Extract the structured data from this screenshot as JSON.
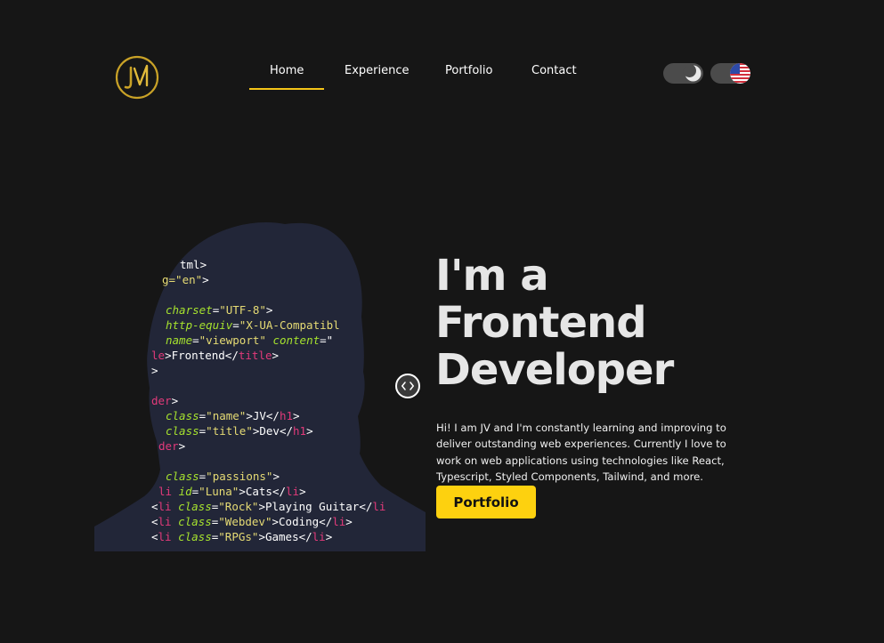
{
  "brand": {
    "logo_text": "JV",
    "accent": "#d4a017"
  },
  "nav": {
    "items": [
      {
        "label": "Home",
        "active": true
      },
      {
        "label": "Experience",
        "active": false
      },
      {
        "label": "Portfolio",
        "active": false
      },
      {
        "label": "Contact",
        "active": false
      }
    ],
    "active_color": "#f5c518"
  },
  "controls": {
    "theme_toggle": {
      "icon": "moon-icon",
      "mode": "dark"
    },
    "language_toggle": {
      "icon": "us-flag-icon"
    }
  },
  "hero_code": [
    [
      [
        "tag",
        "tml>"
      ]
    ],
    [
      [
        "str",
        "g=\"en\""
      ],
      [
        "tag",
        ">"
      ]
    ],
    [],
    [
      [
        "attr",
        "charset"
      ],
      [
        "tag",
        "="
      ],
      [
        "str",
        "\"UTF-8\""
      ],
      [
        "tag",
        ">"
      ]
    ],
    [
      [
        "attr",
        "http-equiv"
      ],
      [
        "tag",
        "="
      ],
      [
        "str",
        "\"X-UA-Compatibl"
      ]
    ],
    [
      [
        "attr",
        "name"
      ],
      [
        "tag",
        "="
      ],
      [
        "str",
        "\"viewport\" "
      ],
      [
        "attr",
        "content"
      ],
      [
        "tag",
        "=\""
      ]
    ],
    [
      [
        "kw",
        "le"
      ],
      [
        "tag",
        ">Frontend</"
      ],
      [
        "kw",
        "title"
      ],
      [
        "tag",
        ">"
      ]
    ],
    [
      [
        "tag",
        ">"
      ]
    ],
    [],
    [
      [
        "kw",
        "der"
      ],
      [
        "tag",
        ">"
      ]
    ],
    [
      [
        "attr",
        "class"
      ],
      [
        "tag",
        "="
      ],
      [
        "str",
        "\"name\""
      ],
      [
        "tag",
        ">JV</"
      ],
      [
        "kw",
        "h1"
      ],
      [
        "tag",
        ">"
      ]
    ],
    [
      [
        "attr",
        "class"
      ],
      [
        "tag",
        "="
      ],
      [
        "str",
        "\"title\""
      ],
      [
        "tag",
        ">Dev</"
      ],
      [
        "kw",
        "h1"
      ],
      [
        "tag",
        ">"
      ]
    ],
    [
      [
        "kw",
        "der"
      ],
      [
        "tag",
        ">"
      ]
    ],
    [],
    [
      [
        "attr",
        "class"
      ],
      [
        "tag",
        "="
      ],
      [
        "str",
        "\"passions\""
      ],
      [
        "tag",
        ">"
      ]
    ],
    [
      [
        "kw",
        "li "
      ],
      [
        "attr",
        "id"
      ],
      [
        "tag",
        "="
      ],
      [
        "str",
        "\"Luna\""
      ],
      [
        "tag",
        ">Cats</"
      ],
      [
        "kw",
        "li"
      ],
      [
        "tag",
        ">"
      ]
    ],
    [
      [
        "tag",
        "<"
      ],
      [
        "kw",
        "li "
      ],
      [
        "attr",
        "class"
      ],
      [
        "tag",
        "="
      ],
      [
        "str",
        "\"Rock\""
      ],
      [
        "tag",
        ">Playing Guitar</"
      ],
      [
        "kw",
        "li"
      ]
    ],
    [
      [
        "tag",
        "<"
      ],
      [
        "kw",
        "li "
      ],
      [
        "attr",
        "class"
      ],
      [
        "tag",
        "="
      ],
      [
        "str",
        "\"Webdev\""
      ],
      [
        "tag",
        ">Coding</"
      ],
      [
        "kw",
        "li"
      ],
      [
        "tag",
        ">"
      ]
    ],
    [
      [
        "tag",
        "<"
      ],
      [
        "kw",
        "li "
      ],
      [
        "attr",
        "class"
      ],
      [
        "tag",
        "="
      ],
      [
        "str",
        "\"RPGs\""
      ],
      [
        "tag",
        ">Games</"
      ],
      [
        "kw",
        "li"
      ],
      [
        "tag",
        ">"
      ]
    ]
  ],
  "hero": {
    "headline": [
      "I'm a",
      "Frontend",
      "Developer"
    ],
    "bio": "Hi! I am JV and I'm constantly learning and improving to deliver outstanding web experiences. Currently I love to work on web applications using technologies like React, Typescript, Styled Components, Tailwind, and more.",
    "cta_label": "Portfolio",
    "cta_color": "#fdd10f"
  }
}
